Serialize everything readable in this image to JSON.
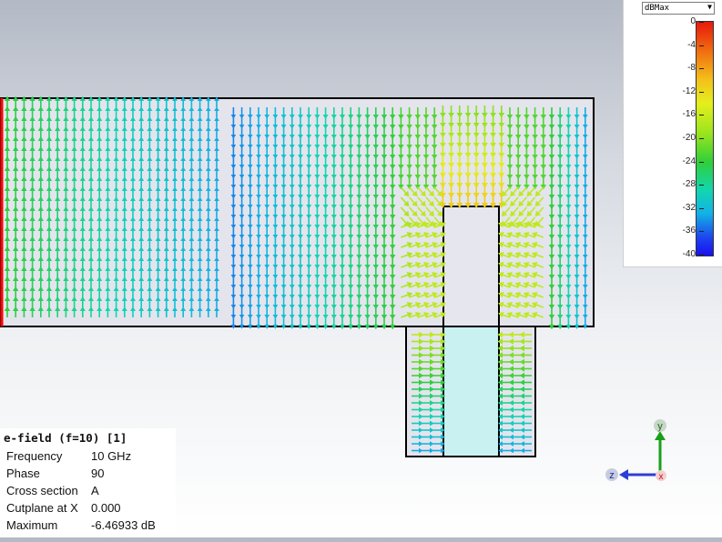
{
  "info": {
    "title": "e-field (f=10) [1]",
    "rows": [
      {
        "key": "Frequency",
        "value": "10 GHz"
      },
      {
        "key": "Phase",
        "value": "90"
      },
      {
        "key": "Cross section",
        "value": "A"
      },
      {
        "key": "Cutplane at X",
        "value": "0.000"
      },
      {
        "key": "Maximum",
        "value": "-6.46933 dB"
      }
    ]
  },
  "legend": {
    "unit_select": "dBMax",
    "ticks": [
      "0",
      "-4",
      "-8",
      "-12",
      "-16",
      "-20",
      "-24",
      "-28",
      "-32",
      "-36",
      "-40"
    ]
  },
  "axes": {
    "y_label": "y",
    "z_label": "z",
    "x_label": "x"
  },
  "colors": {
    "structure_fill": "#e4e4ec",
    "dielectric_fill": "#c8f0f0",
    "outline": "#000000",
    "port_edge": "#ff0000"
  }
}
